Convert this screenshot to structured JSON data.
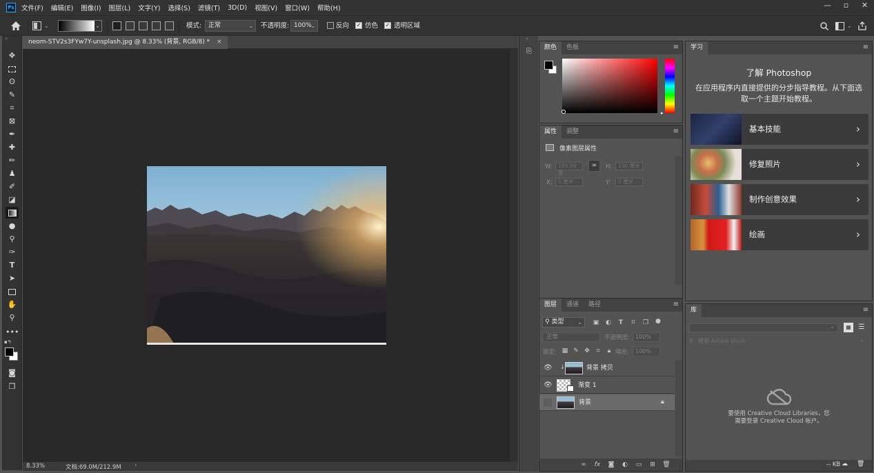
{
  "app": {
    "logo": "Ps"
  },
  "menu": [
    "文件(F)",
    "编辑(E)",
    "图像(I)",
    "图层(L)",
    "文字(Y)",
    "选择(S)",
    "滤镜(T)",
    "3D(D)",
    "视图(V)",
    "窗口(W)",
    "帮助(H)"
  ],
  "window_controls": {
    "minimize": "—",
    "restore": "▫",
    "close": "✕"
  },
  "options": {
    "mode_label": "模式:",
    "mode_value": "正常",
    "opacity_label": "不透明度:",
    "opacity_value": "100%",
    "reverse_label": "反向",
    "reverse_checked": false,
    "dither_label": "仿色",
    "dither_checked": true,
    "transparency_label": "透明区域",
    "transparency_checked": true
  },
  "tools": [
    "move-tool",
    "marquee-tool",
    "lasso-tool",
    "quick-select-tool",
    "crop-tool",
    "frame-tool",
    "eyedropper-tool",
    "healing-brush-tool",
    "brush-tool",
    "clone-stamp-tool",
    "history-brush-tool",
    "eraser-tool",
    "gradient-tool",
    "blur-tool",
    "dodge-tool",
    "pen-tool",
    "type-tool",
    "path-select-tool",
    "rectangle-tool",
    "hand-tool",
    "zoom-tool",
    "more-tools"
  ],
  "selected_tool": "gradient-tool",
  "document": {
    "tab_title": "neom-STV2s3FYw7Y-unsplash.jpg @ 8.33% (背景, RGB/8) *",
    "zoom": "8.33%",
    "doc_info": "文档:69.0M/212.9M"
  },
  "color_panel": {
    "tabs": [
      "颜色",
      "色板"
    ],
    "foreground": "#000000",
    "background": "#ffffff",
    "hue_color": "#ff0000"
  },
  "properties_panel": {
    "tabs": [
      "属性",
      "调整"
    ],
    "title": "像素图层属性",
    "w_label": "W:",
    "w_value": "199.99 厘",
    "h_label": "H:",
    "h_value": "150 厘米",
    "x_label": "X:",
    "x_value": "0 厘米",
    "y_label": "Y:",
    "y_value": "0 厘米"
  },
  "layers_panel": {
    "tabs": [
      "图层",
      "通道",
      "路径"
    ],
    "filter_label": "类型",
    "blend_mode": "正常",
    "opacity_label": "不透明度:",
    "opacity_value": "100%",
    "lock_label": "锁定:",
    "fill_label": "填充:",
    "fill_value": "100%",
    "layers": [
      {
        "name": "背景 拷贝",
        "visible": true,
        "selected": false
      },
      {
        "name": "渐变 1",
        "visible": true,
        "selected": false
      },
      {
        "name": "背景",
        "visible": false,
        "selected": true,
        "locked": true
      }
    ]
  },
  "learn_panel": {
    "tab": "学习",
    "heading": "了解 Photoshop",
    "description": "在应用程序内直接提供的分步指导教程。从下面选取一个主题开始教程。",
    "topics": [
      "基本技能",
      "修复照片",
      "制作创意效果",
      "绘画"
    ]
  },
  "libraries_panel": {
    "tab": "库",
    "search_placeholder": "搜索 Adobe Stock",
    "message": "要使用 Creative Cloud Libraries，您需要登录 Creative Cloud 帐户。",
    "size_label": "-- KB"
  }
}
